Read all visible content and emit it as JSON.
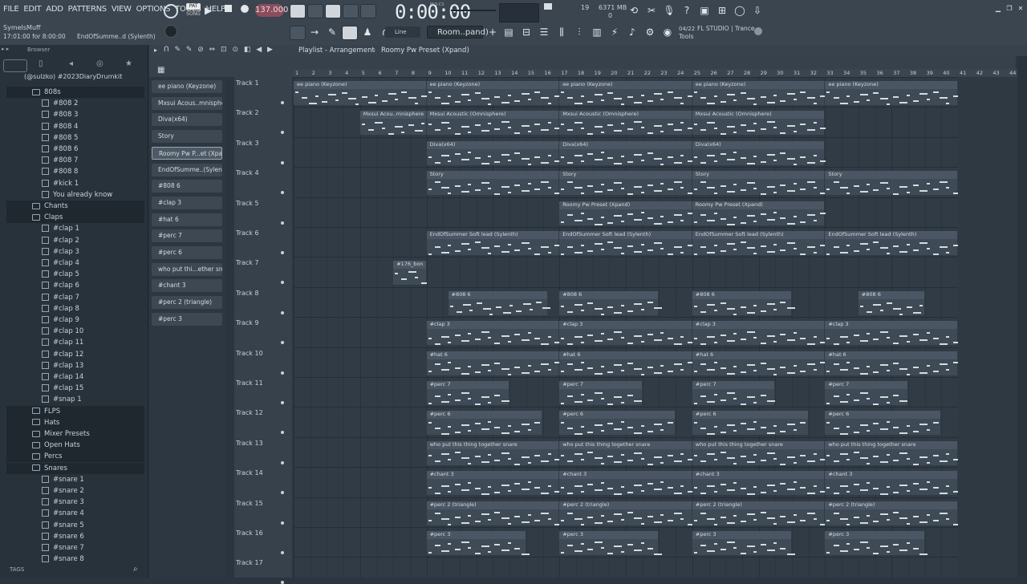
{
  "menu": [
    "FILE",
    "EDIT",
    "ADD",
    "PATTERNS",
    "VIEW",
    "OPTIONS",
    "TOOLS",
    "HELP"
  ],
  "hint": {
    "user": "SymeIsMuff",
    "time_range": "17:01:00 for 8:00:00",
    "current": "EndOfSumme..d (Sylenth)"
  },
  "transport": {
    "pat": "PAT",
    "song": "SONG",
    "tempo": "137.000",
    "time": "0:00:00",
    "msc": "M:S:CS"
  },
  "monitor": {
    "cpu": "19",
    "mem": "6371 MB",
    "poly": "0"
  },
  "snap": {
    "label": "Line"
  },
  "pattern": {
    "name": "Room..pand)"
  },
  "news": {
    "num": "04/22",
    "text1": "FL STUDIO | Trance",
    "text2": "Tools"
  },
  "browser": {
    "header": "Browser",
    "tags": "TAGS"
  },
  "tree_root": "(@sulzko) #2023DiaryDrumkit",
  "tree": [
    {
      "label": "808s",
      "type": "folder",
      "indent": 1
    },
    {
      "label": "#808 2",
      "type": "file",
      "indent": 2
    },
    {
      "label": "#808 3",
      "type": "file",
      "indent": 2
    },
    {
      "label": "#808 4",
      "type": "file",
      "indent": 2
    },
    {
      "label": "#808 5",
      "type": "file",
      "indent": 2
    },
    {
      "label": "#808 6",
      "type": "file",
      "indent": 2
    },
    {
      "label": "#808 7",
      "type": "file",
      "indent": 2
    },
    {
      "label": "#808 8",
      "type": "file",
      "indent": 2
    },
    {
      "label": "#kick 1",
      "type": "file",
      "indent": 2
    },
    {
      "label": "You already know",
      "type": "file",
      "indent": 2
    },
    {
      "label": "Chants",
      "type": "folder",
      "indent": 1
    },
    {
      "label": "Claps",
      "type": "folder",
      "indent": 1
    },
    {
      "label": "#clap 1",
      "type": "file",
      "indent": 2
    },
    {
      "label": "#clap 2",
      "type": "file",
      "indent": 2
    },
    {
      "label": "#clap 3",
      "type": "file",
      "indent": 2
    },
    {
      "label": "#clap 4",
      "type": "file",
      "indent": 2
    },
    {
      "label": "#clap 5",
      "type": "file",
      "indent": 2
    },
    {
      "label": "#clap 6",
      "type": "file",
      "indent": 2
    },
    {
      "label": "#clap 7",
      "type": "file",
      "indent": 2
    },
    {
      "label": "#clap 8",
      "type": "file",
      "indent": 2
    },
    {
      "label": "#clap 9",
      "type": "file",
      "indent": 2
    },
    {
      "label": "#clap 10",
      "type": "file",
      "indent": 2
    },
    {
      "label": "#clap 11",
      "type": "file",
      "indent": 2
    },
    {
      "label": "#clap 12",
      "type": "file",
      "indent": 2
    },
    {
      "label": "#clap 13",
      "type": "file",
      "indent": 2
    },
    {
      "label": "#clap 14",
      "type": "file",
      "indent": 2
    },
    {
      "label": "#clap 15",
      "type": "file",
      "indent": 2
    },
    {
      "label": "#snap 1",
      "type": "file",
      "indent": 2
    },
    {
      "label": "FLPS",
      "type": "folder",
      "indent": 1
    },
    {
      "label": "Hats",
      "type": "folder",
      "indent": 1
    },
    {
      "label": "Mixer Presets",
      "type": "folder",
      "indent": 1
    },
    {
      "label": "Open Hats",
      "type": "folder",
      "indent": 1
    },
    {
      "label": "Percs",
      "type": "folder",
      "indent": 1
    },
    {
      "label": "Snares",
      "type": "folder",
      "indent": 1
    },
    {
      "label": "#snare 1",
      "type": "file",
      "indent": 2
    },
    {
      "label": "#snare 2",
      "type": "file",
      "indent": 2
    },
    {
      "label": "#snare 3",
      "type": "file",
      "indent": 2
    },
    {
      "label": "#snare 4",
      "type": "file",
      "indent": 2
    },
    {
      "label": "#snare 5",
      "type": "file",
      "indent": 2
    },
    {
      "label": "#snare 6",
      "type": "file",
      "indent": 2
    },
    {
      "label": "#snare 7",
      "type": "file",
      "indent": 2
    },
    {
      "label": "#snare 8",
      "type": "file",
      "indent": 2
    }
  ],
  "channels": [
    {
      "label": "ee piano (Keyzone)",
      "active": false
    },
    {
      "label": "Mxsui Acous..mnisphere)",
      "active": false
    },
    {
      "label": "Diva(x64)",
      "active": false
    },
    {
      "label": "Story",
      "active": false
    },
    {
      "label": "Roomy Pw P...et (Xpand)",
      "active": true
    },
    {
      "label": "EndOfSumme..(Sylenth)",
      "active": false
    },
    {
      "label": "#808 6",
      "active": false
    },
    {
      "label": "#clap 3",
      "active": false
    },
    {
      "label": "#hat 6",
      "active": false
    },
    {
      "label": "#perc 7",
      "active": false
    },
    {
      "label": "#perc 6",
      "active": false
    },
    {
      "label": "who put thi...ether snare",
      "active": false
    },
    {
      "label": "#chant 3",
      "active": false
    },
    {
      "label": "#perc 2 (triangle)",
      "active": false
    },
    {
      "label": "#perc 3",
      "active": false
    }
  ],
  "playlist": {
    "title": "Playlist - Arrangement",
    "pattern": "Roomy Pw Preset (Xpand)"
  },
  "tracks": [
    "Track 1",
    "Track 2",
    "Track 3",
    "Track 4",
    "Track 5",
    "Track 6",
    "Track 7",
    "Track 8",
    "Track 9",
    "Track 10",
    "Track 11",
    "Track 12",
    "Track 13",
    "Track 14",
    "Track 15",
    "Track 16",
    "Track 17"
  ],
  "ruler": [
    "1",
    "2",
    "3",
    "4",
    "5",
    "6",
    "7",
    "8",
    "9",
    "10",
    "11",
    "12",
    "13",
    "14",
    "15",
    "16",
    "17",
    "18",
    "19",
    "20",
    "21",
    "22",
    "23",
    "24",
    "25",
    "26",
    "27",
    "28",
    "29",
    "30",
    "31",
    "32",
    "33",
    "34",
    "35",
    "36",
    "37",
    "38",
    "39",
    "40",
    "41",
    "42",
    "43",
    "44"
  ],
  "clips": [
    {
      "track": 0,
      "label": "ee piano (Keyzone)",
      "starts": [
        1,
        9,
        17,
        25,
        33
      ],
      "len": 8
    },
    {
      "track": 1,
      "label": "Mxsui Acou..mnisphere",
      "starts": [
        5
      ],
      "len": 4
    },
    {
      "track": 1,
      "label": "Mxsui Acoustic (Omnisphere)",
      "starts": [
        9,
        17,
        25
      ],
      "len": 8
    },
    {
      "track": 2,
      "label": "Diva(x64)",
      "starts": [
        9,
        17,
        25
      ],
      "len": 8
    },
    {
      "track": 3,
      "label": "Story",
      "starts": [
        9,
        17,
        25,
        33
      ],
      "len": 8
    },
    {
      "track": 4,
      "label": "Roomy Pw Preset (Xpand)",
      "starts": [
        17,
        25
      ],
      "len": 8
    },
    {
      "track": 5,
      "label": "EndOfSummer Soft lead (Sylenth)",
      "starts": [
        9,
        17,
        25,
        33
      ],
      "len": 8
    },
    {
      "track": 6,
      "label": "#176_bon",
      "starts": [
        7
      ],
      "len": 2
    },
    {
      "track": 7,
      "label": "#808 6",
      "starts": [
        10.3,
        17,
        25
      ],
      "len": 6
    },
    {
      "track": 7,
      "label": "#808 6",
      "starts": [
        35
      ],
      "len": 4
    },
    {
      "track": 8,
      "label": "#clap 3",
      "starts": [
        9,
        17,
        25,
        33
      ],
      "len": 8
    },
    {
      "track": 9,
      "label": "#hat 6",
      "starts": [
        9,
        17,
        25,
        33
      ],
      "len": 8
    },
    {
      "track": 10,
      "label": "#perc 7",
      "starts": [
        9,
        17,
        25,
        33
      ],
      "len": 5
    },
    {
      "track": 11,
      "label": "#perc 6",
      "starts": [
        9,
        17,
        25,
        33
      ],
      "len": 7
    },
    {
      "track": 12,
      "label": "who put this thing together snare",
      "starts": [
        9,
        17,
        25,
        33
      ],
      "len": 8
    },
    {
      "track": 13,
      "label": "#chant 3",
      "starts": [
        9,
        17,
        25,
        33
      ],
      "len": 8
    },
    {
      "track": 14,
      "label": "#perc 2 (triangle)",
      "starts": [
        9,
        17,
        25,
        33
      ],
      "len": 8
    },
    {
      "track": 15,
      "label": "#perc 3",
      "starts": [
        9,
        17,
        25,
        33
      ],
      "len": 6
    }
  ]
}
